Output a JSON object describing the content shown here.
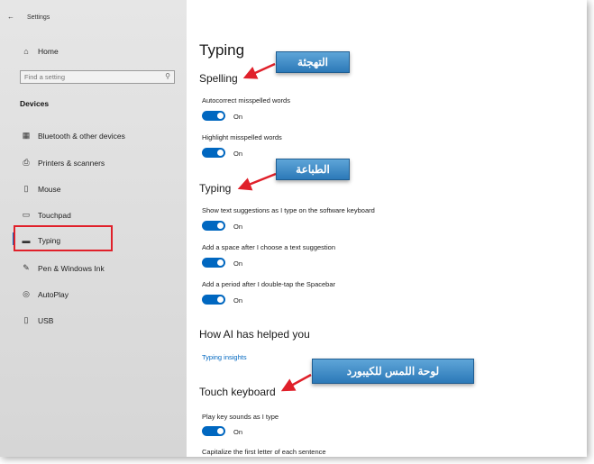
{
  "window": {
    "title": "Settings",
    "back_glyph": "←"
  },
  "sidebar": {
    "home_label": "Home",
    "search_placeholder": "Find a setting",
    "section_label": "Devices",
    "items": [
      {
        "label": "Bluetooth & other devices",
        "icon": "bluetooth-devices-icon",
        "glyph": "▦"
      },
      {
        "label": "Printers & scanners",
        "icon": "printer-icon",
        "glyph": "⎙"
      },
      {
        "label": "Mouse",
        "icon": "mouse-icon",
        "glyph": "▯"
      },
      {
        "label": "Touchpad",
        "icon": "touchpad-icon",
        "glyph": "▭"
      },
      {
        "label": "Typing",
        "icon": "keyboard-icon",
        "glyph": "▬"
      },
      {
        "label": "Pen & Windows Ink",
        "icon": "pen-icon",
        "glyph": "✎"
      },
      {
        "label": "AutoPlay",
        "icon": "autoplay-icon",
        "glyph": "◎"
      },
      {
        "label": "USB",
        "icon": "usb-icon",
        "glyph": "▯"
      }
    ],
    "active_item": "Typing",
    "home_glyph": "⌂",
    "search_glyph": "⚲"
  },
  "main": {
    "page_title": "Typing",
    "spelling": {
      "heading": "Spelling",
      "autocorrect_label": "Autocorrect misspelled words",
      "autocorrect_state": "On",
      "highlight_label": "Highlight misspelled words",
      "highlight_state": "On"
    },
    "typing": {
      "heading": "Typing",
      "suggestions_label": "Show text suggestions as I type on the software keyboard",
      "suggestions_state": "On",
      "space_label": "Add a space after I choose a text suggestion",
      "space_state": "On",
      "period_label": "Add a period after I double-tap the Spacebar",
      "period_state": "On"
    },
    "ai": {
      "heading": "How AI has helped you",
      "link": "Typing insights"
    },
    "touch": {
      "heading": "Touch keyboard",
      "key_sounds_label": "Play key sounds as I type",
      "key_sounds_state": "On",
      "capitalize_label": "Capitalize the first letter of each sentence"
    }
  },
  "annotations": {
    "spelling_callout": "التهجئة",
    "typing_callout": "الطباعة",
    "touch_callout": "لوحة اللمس للكيبورد",
    "callout_color": "#2c79b8",
    "arrow_color": "#e0202a",
    "highlight_color": "#e0202a"
  },
  "colors": {
    "accent": "#0067c0"
  }
}
